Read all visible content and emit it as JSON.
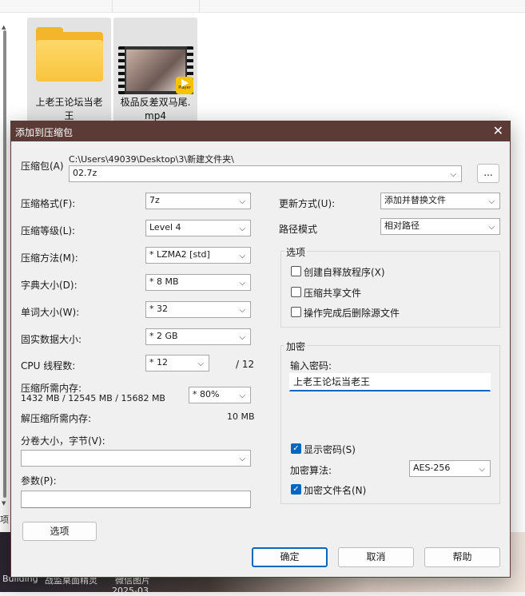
{
  "explorer": {
    "files": [
      {
        "name_line1": "上老王论坛当老",
        "name_line2": "王",
        "type": "folder"
      },
      {
        "name_line1": "极品反差双马尾.",
        "name_line2": "mp4",
        "type": "video",
        "badge": "Player"
      }
    ],
    "bottom_labels": [
      "Building",
      "战监桌面精灵",
      "微信图片",
      "2025-03"
    ],
    "left_glyph": "项"
  },
  "dialog": {
    "title": "添加到压缩包",
    "archive_label": "压缩包(A)",
    "archive_path": "C:\\Users\\49039\\Desktop\\3\\新建文件夹\\",
    "archive_name": "02.7z",
    "browse_label": "...",
    "left": {
      "format_label": "压缩格式(F):",
      "format_value": "7z",
      "level_label": "压缩等级(L):",
      "level_value": "Level 4",
      "method_label": "压缩方法(M):",
      "method_value": "*  LZMA2 [std]",
      "dict_label": "字典大小(D):",
      "dict_value": "*  8 MB",
      "word_label": "单词大小(W):",
      "word_value": "*  32",
      "solid_label": "固实数据大小:",
      "solid_value": "*  2 GB",
      "cpu_label": "CPU 线程数:",
      "cpu_value": "*  12",
      "cpu_total": "/ 12",
      "mem_label": "压缩所需内存:",
      "mem_value": "1432 MB / 12545 MB / 15682 MB",
      "mem_percent": "* 80%",
      "decomp_label": "解压缩所需内存:",
      "decomp_value": "10 MB",
      "volume_label": "分卷大小，字节(V):",
      "volume_value": "",
      "params_label": "参数(P):",
      "params_value": "",
      "options_button": "选项"
    },
    "right": {
      "update_label": "更新方式(U):",
      "update_value": "添加并替换文件",
      "path_label": "路径模式",
      "path_value": "相对路径",
      "options_group": "选项",
      "opt_sfx": "创建自释放程序(X)",
      "opt_shared": "压缩共享文件",
      "opt_delete": "操作完成后删除源文件",
      "encrypt_group": "加密",
      "password_label": "输入密码:",
      "password_value": "上老王论坛当老王",
      "show_password": "显示密码(S)",
      "method_label": "加密算法:",
      "method_value": "AES-256",
      "encrypt_names": "加密文件名(N)"
    },
    "buttons": {
      "ok": "确定",
      "cancel": "取消",
      "help": "帮助"
    }
  },
  "colors": {
    "titlebar": "#5c3b37",
    "accent": "#0067c0",
    "folder": "#f2b52b"
  }
}
